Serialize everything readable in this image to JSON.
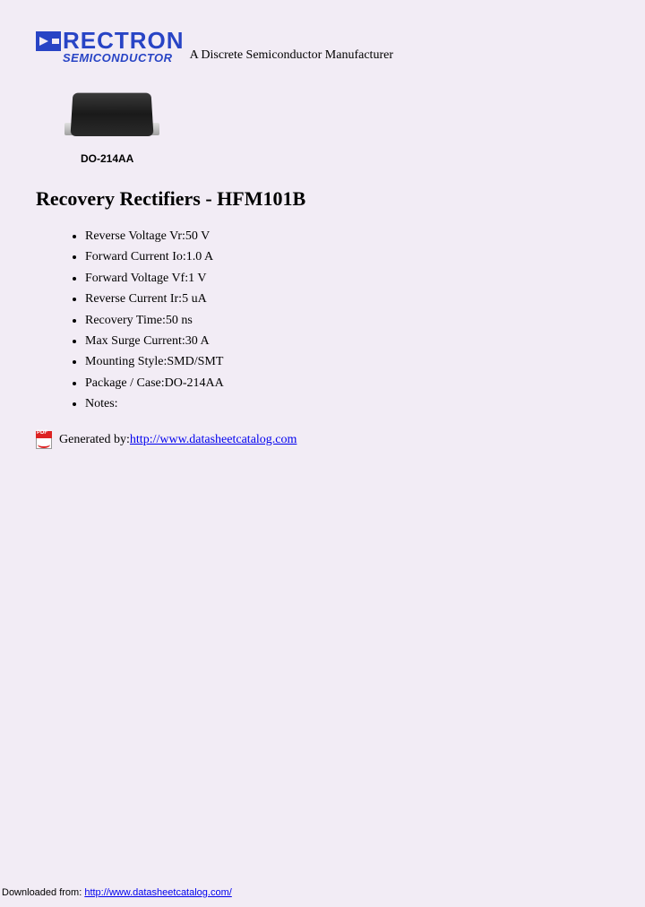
{
  "logo": {
    "line1": "RECTRON",
    "line2": "SEMICONDUCTOR"
  },
  "tagline": "A Discrete Semiconductor Manufacturer",
  "component": {
    "label": "DO-214AA"
  },
  "title": "Recovery Rectifiers - HFM101B",
  "specs": [
    "Reverse Voltage Vr:50 V",
    "Forward Current Io:1.0 A",
    "Forward Voltage Vf:1 V",
    "Reverse Current Ir:5 uA",
    "Recovery Time:50 ns",
    "Max Surge Current:30 A",
    "Mounting Style:SMD/SMT",
    "Package / Case:DO-214AA",
    "Notes:"
  ],
  "generated": {
    "prefix": "Generated by: ",
    "link": "http://www.datasheetcatalog.com"
  },
  "footer": {
    "prefix": "Downloaded from: ",
    "link": "http://www.datasheetcatalog.com/"
  }
}
